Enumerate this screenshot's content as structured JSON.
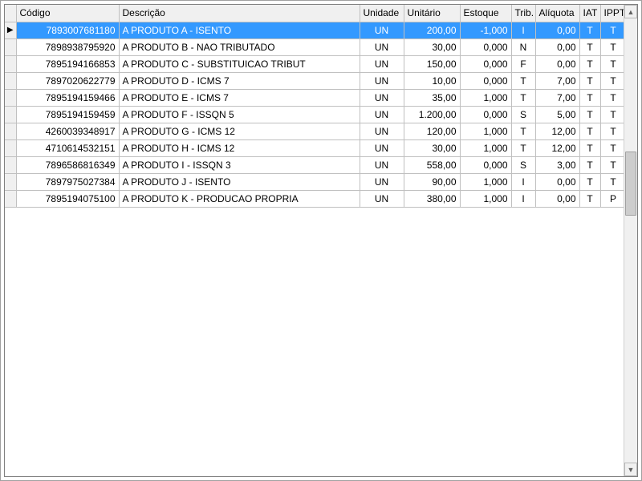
{
  "columns": {
    "codigo": "Código",
    "descricao": "Descrição",
    "unidade": "Unidade",
    "unitario": "Unitário",
    "estoque": "Estoque",
    "trib": "Trib.",
    "aliquota": "Alíquota",
    "iat": "IAT",
    "ippt": "IPPT"
  },
  "rows": [
    {
      "codigo": "7893007681180",
      "descricao": "A PRODUTO A - ISENTO",
      "unidade": "UN",
      "unitario": "200,00",
      "estoque": "-1,000",
      "trib": "I",
      "aliquota": "0,00",
      "iat": "T",
      "ippt": "T",
      "selected": true
    },
    {
      "codigo": "7898938795920",
      "descricao": "A PRODUTO B - NAO TRIBUTADO",
      "unidade": "UN",
      "unitario": "30,00",
      "estoque": "0,000",
      "trib": "N",
      "aliquota": "0,00",
      "iat": "T",
      "ippt": "T",
      "selected": false
    },
    {
      "codigo": "7895194166853",
      "descricao": "A PRODUTO C - SUBSTITUICAO TRIBUT",
      "unidade": "UN",
      "unitario": "150,00",
      "estoque": "0,000",
      "trib": "F",
      "aliquota": "0,00",
      "iat": "T",
      "ippt": "T",
      "selected": false
    },
    {
      "codigo": "7897020622779",
      "descricao": "A PRODUTO D - ICMS 7",
      "unidade": "UN",
      "unitario": "10,00",
      "estoque": "0,000",
      "trib": "T",
      "aliquota": "7,00",
      "iat": "T",
      "ippt": "T",
      "selected": false
    },
    {
      "codigo": "7895194159466",
      "descricao": "A PRODUTO E - ICMS 7",
      "unidade": "UN",
      "unitario": "35,00",
      "estoque": "1,000",
      "trib": "T",
      "aliquota": "7,00",
      "iat": "T",
      "ippt": "T",
      "selected": false
    },
    {
      "codigo": "7895194159459",
      "descricao": "A PRODUTO F - ISSQN 5",
      "unidade": "UN",
      "unitario": "1.200,00",
      "estoque": "0,000",
      "trib": "S",
      "aliquota": "5,00",
      "iat": "T",
      "ippt": "T",
      "selected": false
    },
    {
      "codigo": "4260039348917",
      "descricao": "A PRODUTO G - ICMS 12",
      "unidade": "UN",
      "unitario": "120,00",
      "estoque": "1,000",
      "trib": "T",
      "aliquota": "12,00",
      "iat": "T",
      "ippt": "T",
      "selected": false
    },
    {
      "codigo": "4710614532151",
      "descricao": "A PRODUTO H - ICMS 12",
      "unidade": "UN",
      "unitario": "30,00",
      "estoque": "1,000",
      "trib": "T",
      "aliquota": "12,00",
      "iat": "T",
      "ippt": "T",
      "selected": false
    },
    {
      "codigo": "7896586816349",
      "descricao": "A PRODUTO I - ISSQN 3",
      "unidade": "UN",
      "unitario": "558,00",
      "estoque": "0,000",
      "trib": "S",
      "aliquota": "3,00",
      "iat": "T",
      "ippt": "T",
      "selected": false
    },
    {
      "codigo": "7897975027384",
      "descricao": "A PRODUTO J - ISENTO",
      "unidade": "UN",
      "unitario": "90,00",
      "estoque": "1,000",
      "trib": "I",
      "aliquota": "0,00",
      "iat": "T",
      "ippt": "T",
      "selected": false
    },
    {
      "codigo": "7895194075100",
      "descricao": "A PRODUTO K - PRODUCAO PROPRIA",
      "unidade": "UN",
      "unitario": "380,00",
      "estoque": "1,000",
      "trib": "I",
      "aliquota": "0,00",
      "iat": "T",
      "ippt": "P",
      "selected": false
    }
  ],
  "icons": {
    "current_row": "▶",
    "scroll_up": "▲",
    "scroll_down": "▼"
  }
}
